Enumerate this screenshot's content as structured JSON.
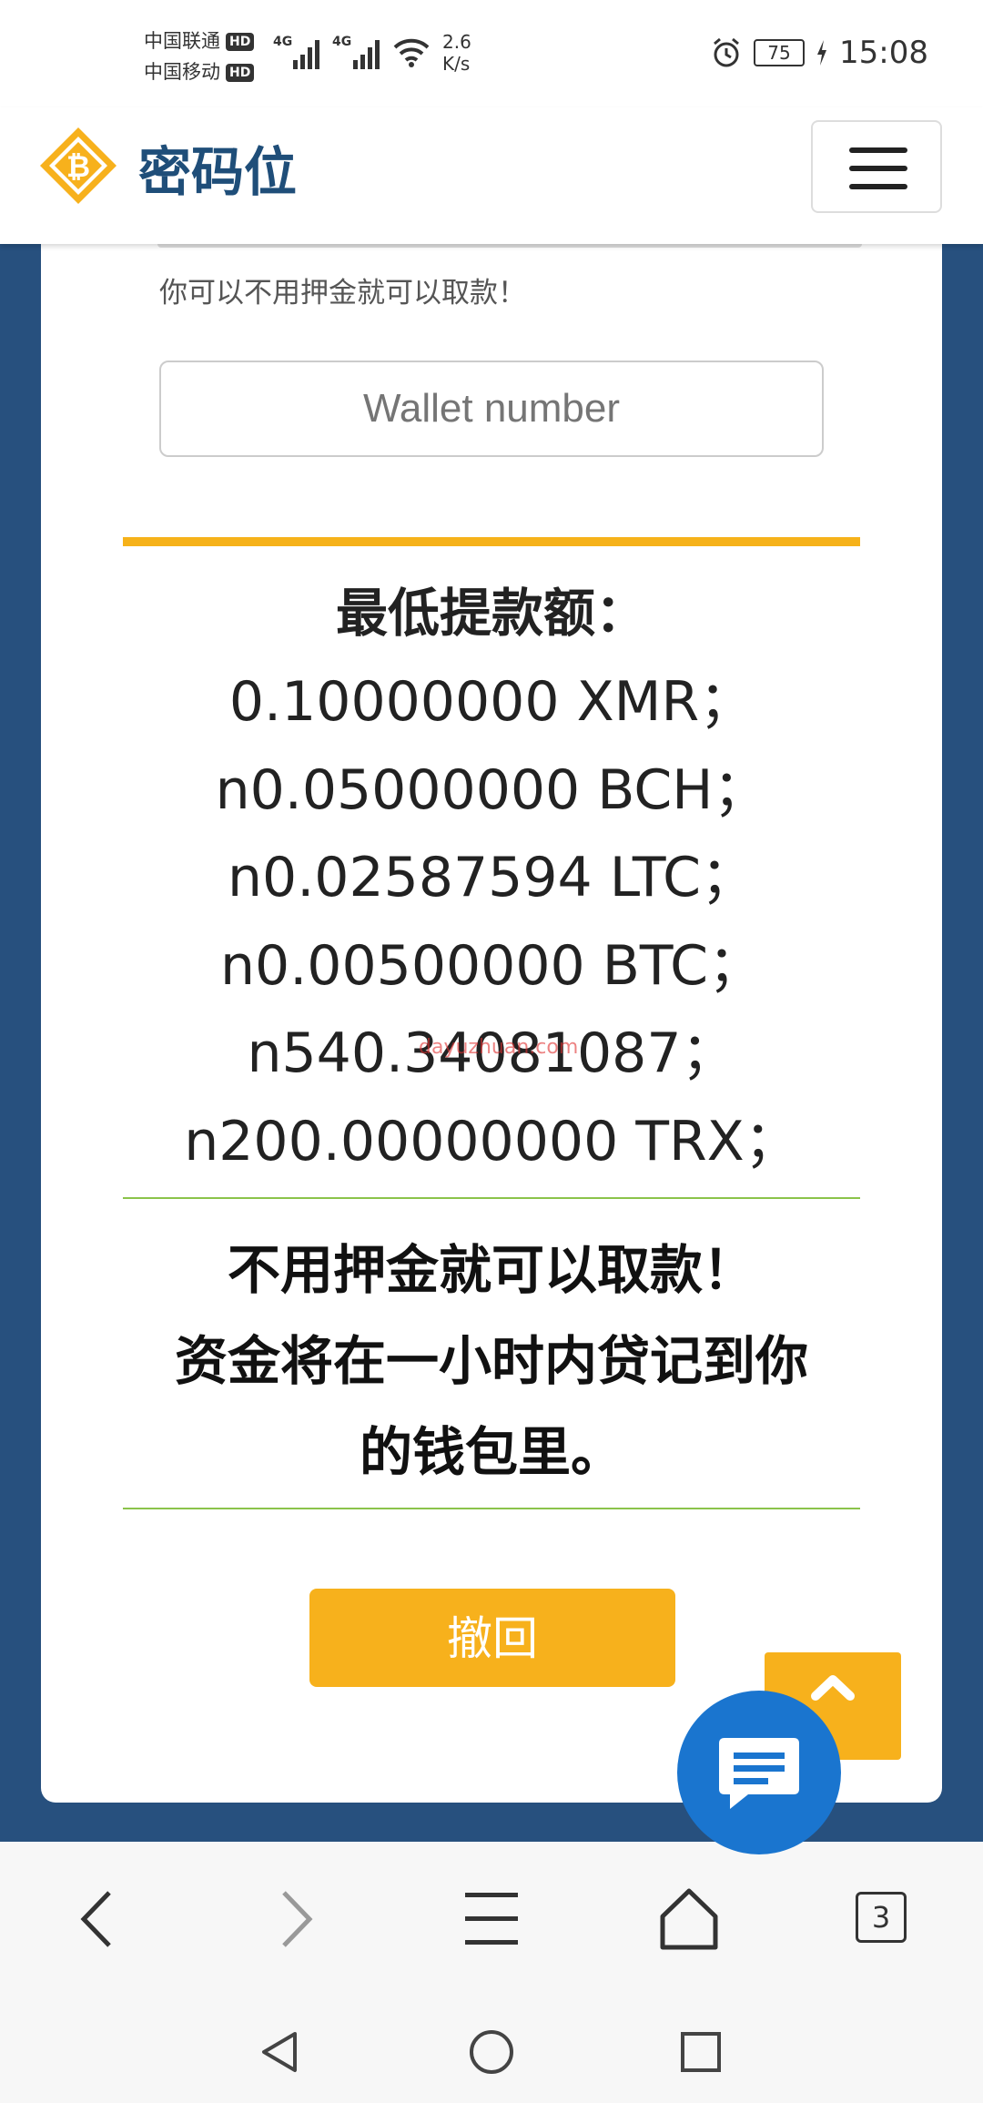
{
  "status_bar": {
    "carrier1": "中国联通",
    "carrier2": "中国移动",
    "hd_badge": "HD",
    "network1": "4G",
    "network2": "4G",
    "speed_value": "2.6",
    "speed_unit": "K/s",
    "battery": "75",
    "time": "15:08"
  },
  "header": {
    "site_name": "密码位",
    "logo_icon": "bitcoin-diamond-icon",
    "menu_icon": "hamburger-icon"
  },
  "form": {
    "note": "你可以不用押金就可以取款！",
    "wallet_placeholder": "Wallet number"
  },
  "minimums": {
    "title": "最低提款额：",
    "lines": [
      "0.10000000 XMR；",
      "n0.05000000 BCH；",
      "n0.02587594 LTC；",
      "n0.00500000 BTC；",
      "n540.34081087；",
      "n200.00000000 TRX；"
    ]
  },
  "notice": {
    "line1": "不用押金就可以取款！",
    "line2": "资金将在一小时内贷记到你",
    "line3": "的钱包里。"
  },
  "withdraw_button": "撤回",
  "watermark": "dayuzhuan.com",
  "browser_nav": {
    "tabs_count": "3"
  },
  "colors": {
    "brand_blue": "#1f4e79",
    "page_bg": "#27507e",
    "accent_gold": "#f7b11c",
    "divider_green": "#8bc34a",
    "chat_blue": "#1a75cf"
  }
}
